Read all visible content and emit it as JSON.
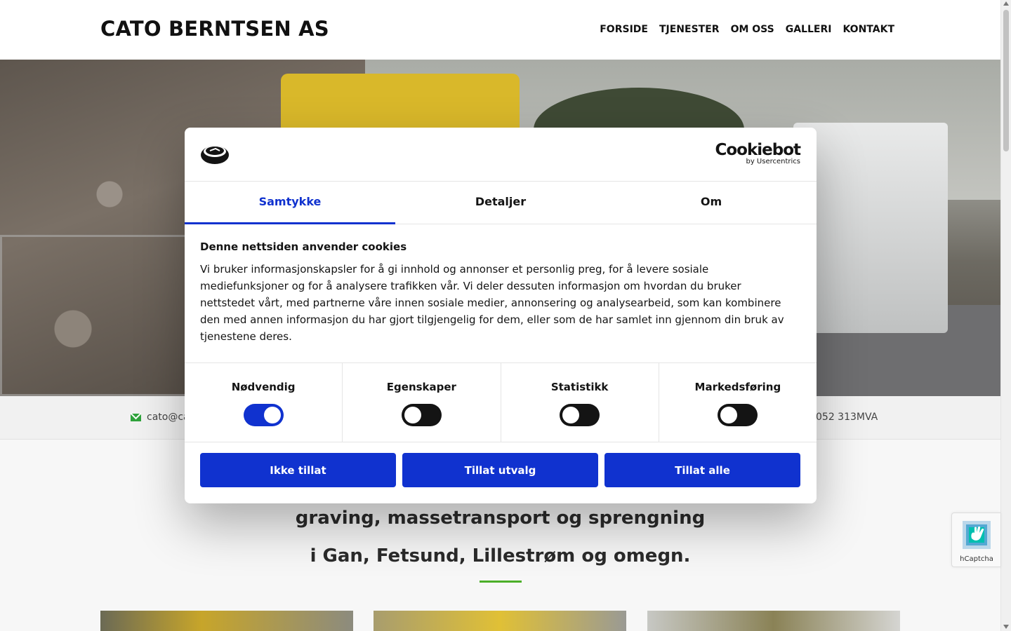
{
  "header": {
    "brand": "CATO BERNTSEN AS",
    "nav": [
      "FORSIDE",
      "TJENESTER",
      "OM OSS",
      "GALLERI",
      "KONTAKT"
    ]
  },
  "contact_bar": {
    "email_partial": "cato@ca",
    "org_partial": "052 313MVA"
  },
  "intro": {
    "line1": "graving, massetransport og sprengning",
    "line2": "i Gan, Fetsund, Lillestrøm og omegn."
  },
  "cookie_dialog": {
    "brand": "Cookiebot",
    "brand_sub": "by Usercentrics",
    "tabs": [
      "Samtykke",
      "Detaljer",
      "Om"
    ],
    "active_tab": "Samtykke",
    "title": "Denne nettsiden anvender cookies",
    "text": "Vi bruker informasjonskapsler for å gi innhold og annonser et personlig preg, for å levere sosiale mediefunksjoner og for å analysere trafikken vår. Vi deler dessuten informasjon om hvordan du bruker nettstedet vårt, med partnerne våre innen sosiale medier, annonsering og analysearbeid, som kan kombinere den med annen informasjon du har gjort tilgjengelig for dem, eller som de har samlet inn gjennom din bruk av tjenestene deres.",
    "toggles": [
      {
        "label": "Nødvendig",
        "on": true
      },
      {
        "label": "Egenskaper",
        "on": false
      },
      {
        "label": "Statistikk",
        "on": false
      },
      {
        "label": "Markedsføring",
        "on": false
      }
    ],
    "buttons": [
      "Ikke tillat",
      "Tillat utvalg",
      "Tillat alle"
    ],
    "accent_color": "#1032cf"
  },
  "hcaptcha": {
    "label": "hCaptcha"
  }
}
